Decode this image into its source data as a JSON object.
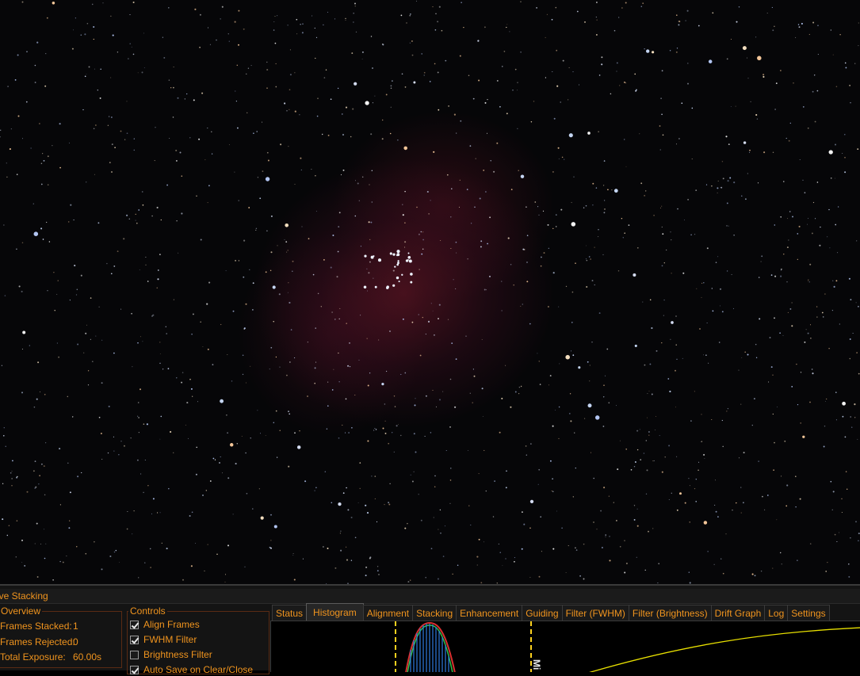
{
  "panel": {
    "title": "ive Stacking"
  },
  "overview": {
    "title": "Overview",
    "rows": [
      {
        "label": "Frames Stacked:",
        "value": "1"
      },
      {
        "label": "Frames Rejected:",
        "value": "0"
      },
      {
        "label": "Total Exposure:",
        "value": "60.00s"
      }
    ]
  },
  "controls": {
    "title": "Controls",
    "items": [
      {
        "label": "Align Frames",
        "checked": true
      },
      {
        "label": "FWHM Filter",
        "checked": true
      },
      {
        "label": "Brightness Filter",
        "checked": false
      },
      {
        "label": "Auto Save on Clear/Close",
        "checked": true
      }
    ]
  },
  "tabs": [
    {
      "label": "Status",
      "active": false
    },
    {
      "label": "Histogram",
      "active": true
    },
    {
      "label": "Alignment",
      "active": false
    },
    {
      "label": "Stacking",
      "active": false
    },
    {
      "label": "Enhancement",
      "active": false
    },
    {
      "label": "Guiding",
      "active": false
    },
    {
      "label": "Filter (FWHM)",
      "active": false
    },
    {
      "label": "Filter (Brightness)",
      "active": false
    },
    {
      "label": "Drift Graph",
      "active": false
    },
    {
      "label": "Log",
      "active": false
    },
    {
      "label": "Settings",
      "active": false
    }
  ],
  "histogram": {
    "marker_label": "Mi"
  },
  "colors": {
    "accent": "#f0941e",
    "background": "#141414",
    "curve": "#e8e000",
    "marker": "#ffd21e"
  }
}
